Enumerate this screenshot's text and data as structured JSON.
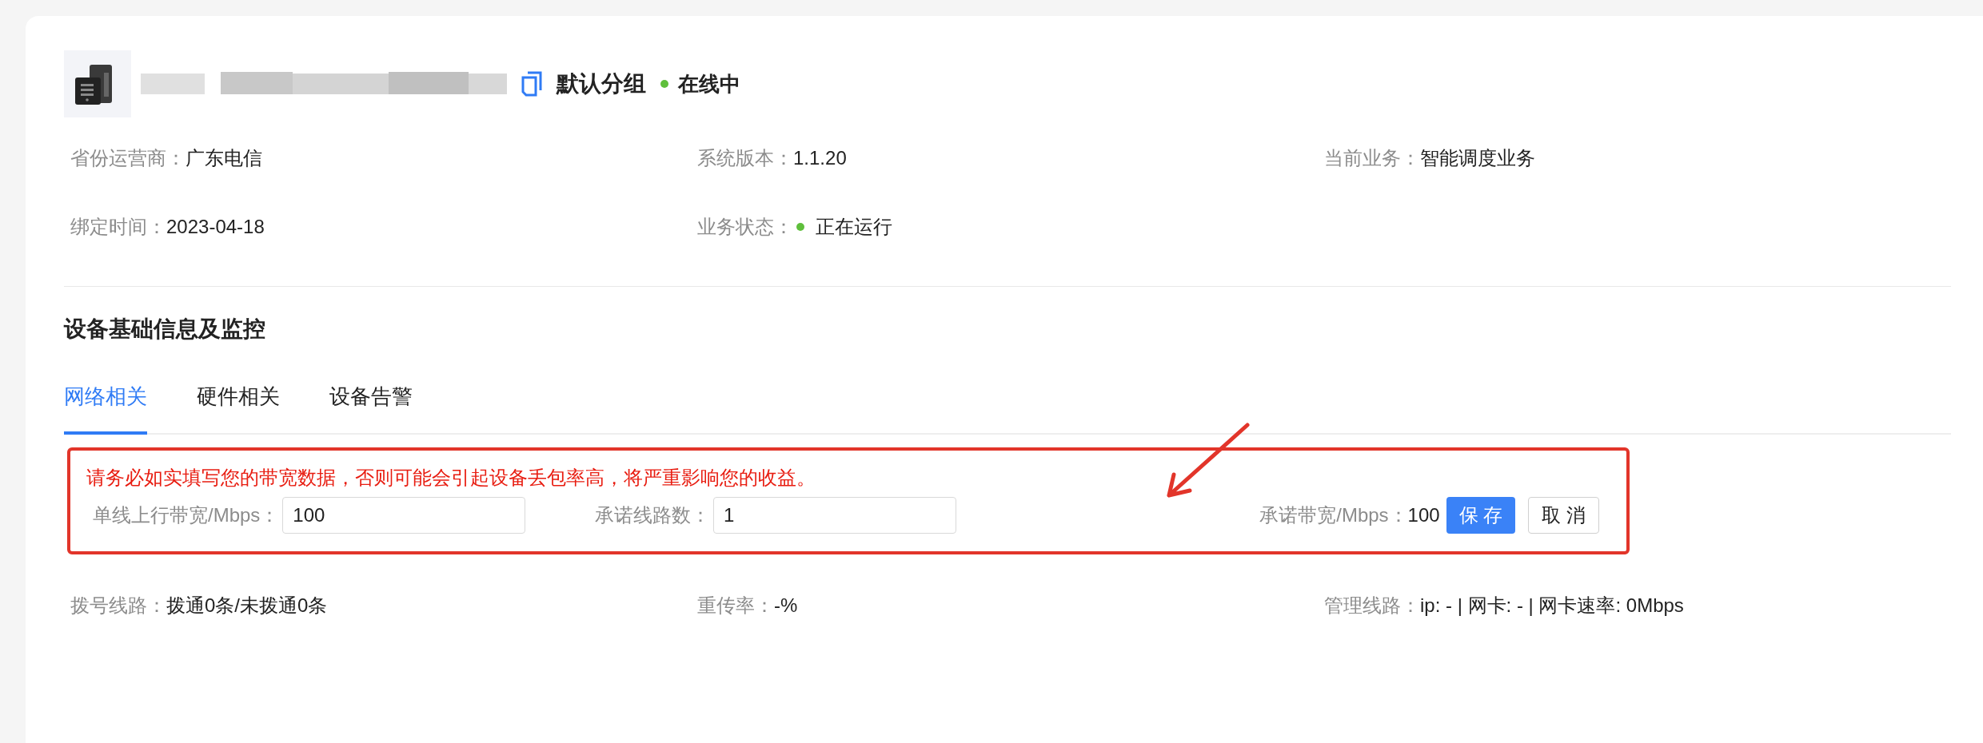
{
  "device": {
    "group": "默认分组",
    "status": {
      "label": "在线中",
      "color": "#5fbf3c"
    }
  },
  "info": [
    {
      "label": "省份运营商：",
      "value": "广东电信"
    },
    {
      "label": "系统版本：",
      "value": "1.1.20"
    },
    {
      "label": "当前业务：",
      "value": "智能调度业务"
    },
    {
      "label": "绑定时间：",
      "value": "2023-04-18"
    },
    {
      "label": "业务状态：",
      "value": "正在运行",
      "color": "#5fbf3c"
    }
  ],
  "section_title": "设备基础信息及监控",
  "tabs": [
    {
      "label": "网络相关",
      "selected": true
    },
    {
      "label": "硬件相关",
      "selected": false
    },
    {
      "label": "设备告警",
      "selected": false
    }
  ],
  "warning": "请务必如实填写您的带宽数据，否则可能会引起设备丢包率高，将严重影响您的收益。",
  "form": {
    "fields": [
      {
        "label": "单线上行带宽/Mbps：",
        "value": "100"
      },
      {
        "label": "承诺线路数：",
        "value": "1"
      }
    ],
    "result": {
      "label": "承诺带宽/Mbps：",
      "value": "100"
    },
    "buttons": [
      {
        "label": "保 存",
        "kind": "primary"
      },
      {
        "label": "取 消",
        "kind": "default"
      }
    ]
  },
  "stats": [
    {
      "label": "拨号线路：",
      "value": "拨通0条/未拨通0条"
    },
    {
      "label": "重传率：",
      "value": "-%"
    },
    {
      "label": "管理线路：",
      "value": "ip: - | 网卡: - | 网卡速率: 0Mbps"
    }
  ]
}
